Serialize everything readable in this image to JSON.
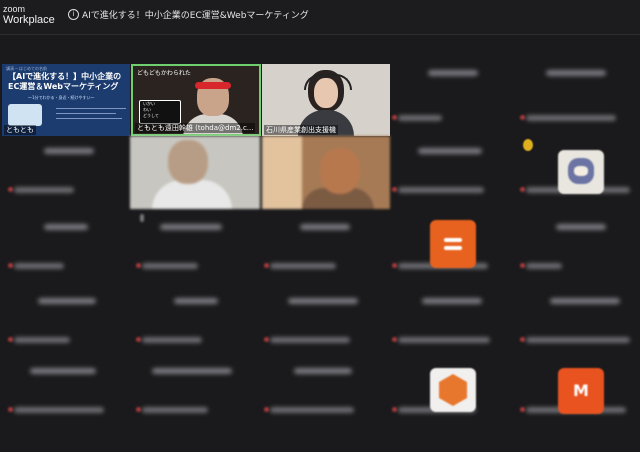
{
  "app": {
    "brand_top": "zoom",
    "brand_bottom": "Workplace"
  },
  "meeting": {
    "title": "AIで進化する！中小企業のEC運営&Webマーケティング"
  },
  "slide": {
    "header_small": "講演 ─ はじめての名前",
    "title": "【AIで進化する！】中小企業のEC運営＆Webマーケティング",
    "subtitle": "～1分でわかる・身近・続けやすい～",
    "label": "ともとも"
  },
  "speaker": {
    "overlay_text": "どもどもかわられた",
    "bubble_lines": [
      "いかい",
      "わい",
      "どうして"
    ],
    "label": "ともとも遠田幹雄 (tohda@dm2.c..."
  },
  "ishikawa": {
    "label": "石川県産業創出支援機"
  },
  "colors": {
    "active_speaker_border": "#6fcf6f",
    "muted_icon": "#b23a3a",
    "avatar_orange": "#e8621f"
  },
  "avatars": {
    "m_letter": "M"
  }
}
